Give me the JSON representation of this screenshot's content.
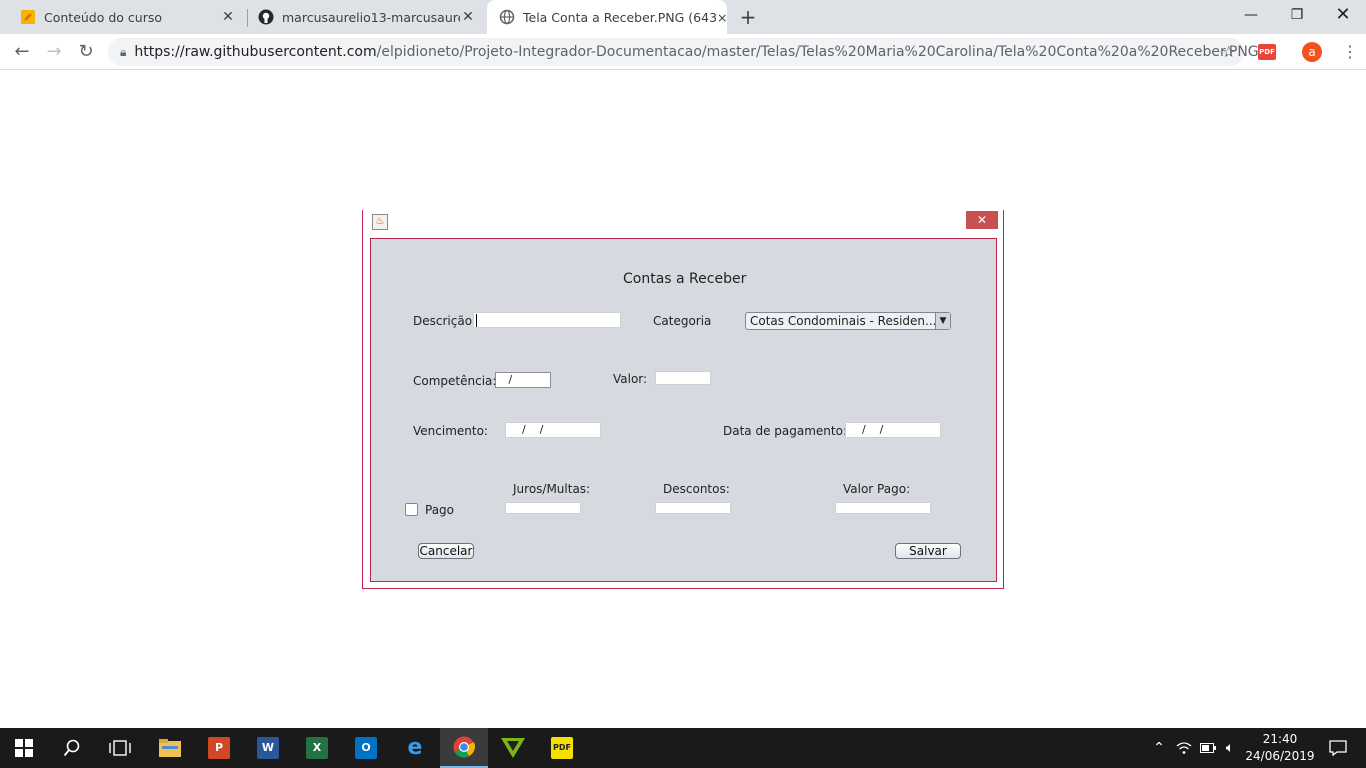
{
  "browser": {
    "tabs": [
      {
        "title": "Conteúdo do curso",
        "icon": "pencil-icon",
        "active": false
      },
      {
        "title": "marcusaurelio13-marcusaurelio1",
        "icon": "github-icon",
        "active": false
      },
      {
        "title": "Tela Conta a Receber.PNG (643×",
        "icon": "globe-icon",
        "active": true
      }
    ],
    "new_tab_label": "+",
    "url_host": "https://raw.githubusercontent.com",
    "url_path": "/elpidioneto/Projeto-Integrador-Documentacao/master/Telas/Telas%20Maria%20Carolina/Tela%20Conta%20a%20Receber.PNG",
    "profile_letter": "a",
    "pdf_extension_label": "PDF",
    "accent_color": "#b5284c"
  },
  "form": {
    "title": "Contas a Receber",
    "descricao_label": "Descrição:",
    "descricao_value": "",
    "categoria_label": "Categoria",
    "categoria_value": "Cotas Condominais - Residen...",
    "competencia_label": "Competência:",
    "competencia_value": "   /",
    "valor_label": "Valor:",
    "valor_value": "",
    "vencimento_label": "Vencimento:",
    "vencimento_value": "    /    /",
    "data_pagamento_label": "Data de pagamento:",
    "data_pagamento_value": "    /    /",
    "pago_label": "Pago",
    "juros_label": "Juros/Multas:",
    "descontos_label": "Descontos:",
    "valor_pago_label": "Valor Pago:",
    "cancelar_label": "Cancelar",
    "salvar_label": "Salvar"
  },
  "taskbar": {
    "apps": [
      {
        "name": "file-explorer",
        "label": ""
      },
      {
        "name": "powerpoint",
        "label": "P"
      },
      {
        "name": "word",
        "label": "W"
      },
      {
        "name": "excel",
        "label": "X"
      },
      {
        "name": "outlook",
        "label": "O"
      },
      {
        "name": "edge",
        "label": "e"
      },
      {
        "name": "chrome",
        "label": ""
      },
      {
        "name": "vlc-like",
        "label": ""
      },
      {
        "name": "pdf-app",
        "label": "PDF"
      }
    ],
    "time": "21:40",
    "date": "24/06/2019"
  }
}
